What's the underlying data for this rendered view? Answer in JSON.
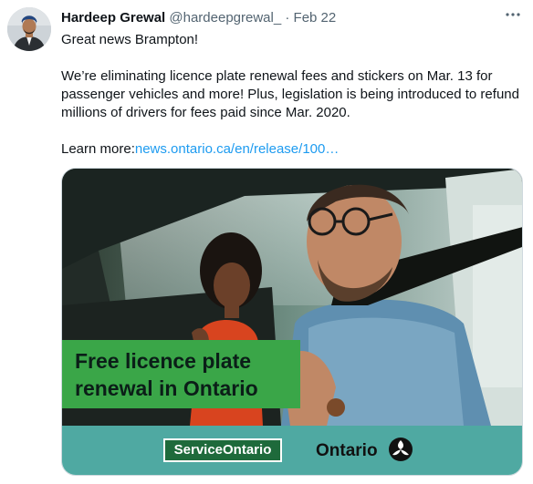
{
  "tweet": {
    "author_name": "Hardeep Grewal",
    "handle": "@hardeepgrewal_",
    "separator": "·",
    "date": "Feb 22",
    "more_icon": "more-horizontal-icon",
    "paragraphs": [
      "Great news Brampton!",
      "We’re eliminating licence plate renewal fees and stickers on Mar. 13 for passenger vehicles and more! Plus, legislation is being introduced to refund millions of drivers for fees paid since Mar. 2020."
    ],
    "learn_more_label": "Learn more:",
    "link_text": "news.ontario.ca/en/release/100…"
  },
  "media": {
    "banner_line1": "Free licence plate",
    "banner_line2": "renewal in Ontario",
    "service_ontario_logo": "ServiceOntario",
    "ontario_logo": "Ontario",
    "trillium_icon": "ontario-trillium-icon"
  },
  "colors": {
    "link": "#1d9bf0",
    "banner_green": "#3aa648",
    "footer_teal": "#4fa9a2",
    "service_ontario_green": "#1e6a3b"
  }
}
